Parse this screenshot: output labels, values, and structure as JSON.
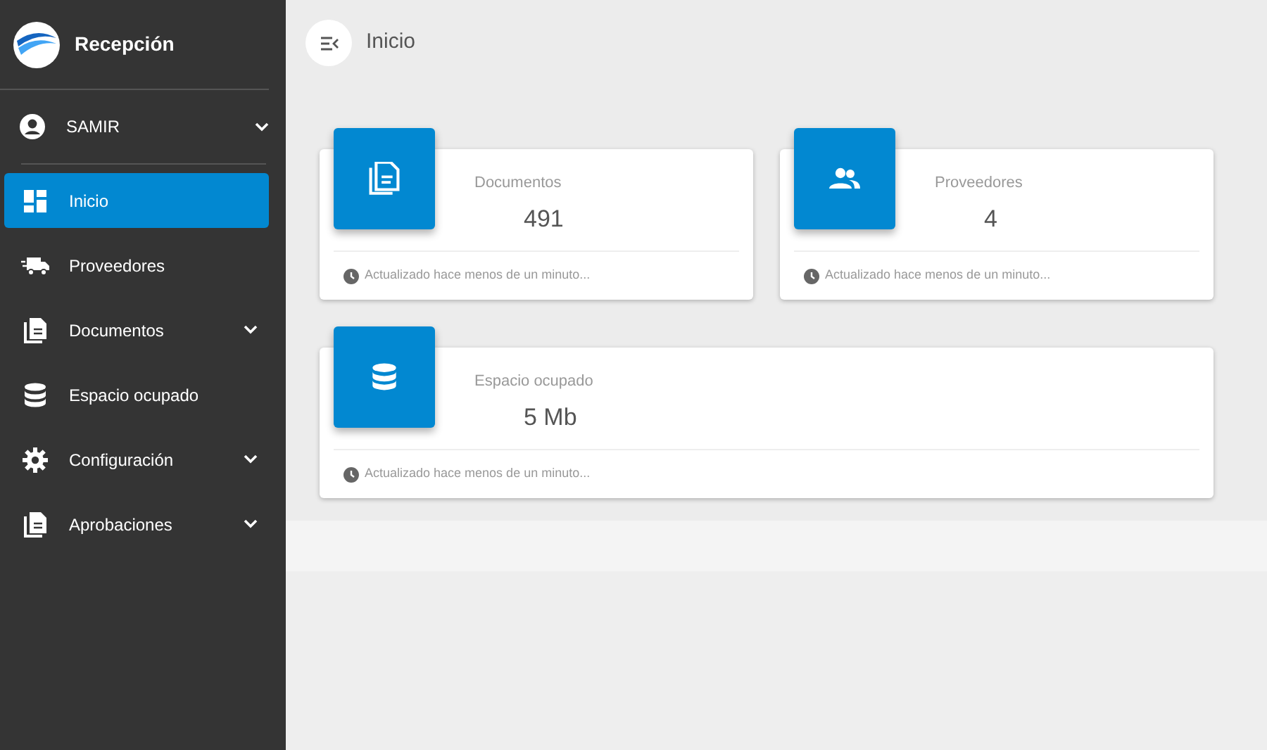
{
  "brand": {
    "title": "Recepción"
  },
  "user": {
    "name": "SAMIR",
    "expandable": true
  },
  "sidebar": {
    "items": [
      {
        "label": "Inicio",
        "selected": true,
        "expandable": false
      },
      {
        "label": "Proveedores",
        "selected": false,
        "expandable": false
      },
      {
        "label": "Documentos",
        "selected": false,
        "expandable": true
      },
      {
        "label": "Espacio ocupado",
        "selected": false,
        "expandable": false
      },
      {
        "label": "Configuración",
        "selected": false,
        "expandable": true
      },
      {
        "label": "Aprobaciones",
        "selected": false,
        "expandable": true
      }
    ]
  },
  "header": {
    "title": "Inicio"
  },
  "stats": [
    {
      "title": "Documentos",
      "value": "491",
      "footer": "Actualizado hace menos de un minuto..."
    },
    {
      "title": "Proveedores",
      "value": "4",
      "footer": "Actualizado hace menos de un minuto..."
    },
    {
      "title": "Espacio ocupado",
      "value": "5 Mb",
      "footer": "Actualizado hace menos de un minuto..."
    }
  ]
}
